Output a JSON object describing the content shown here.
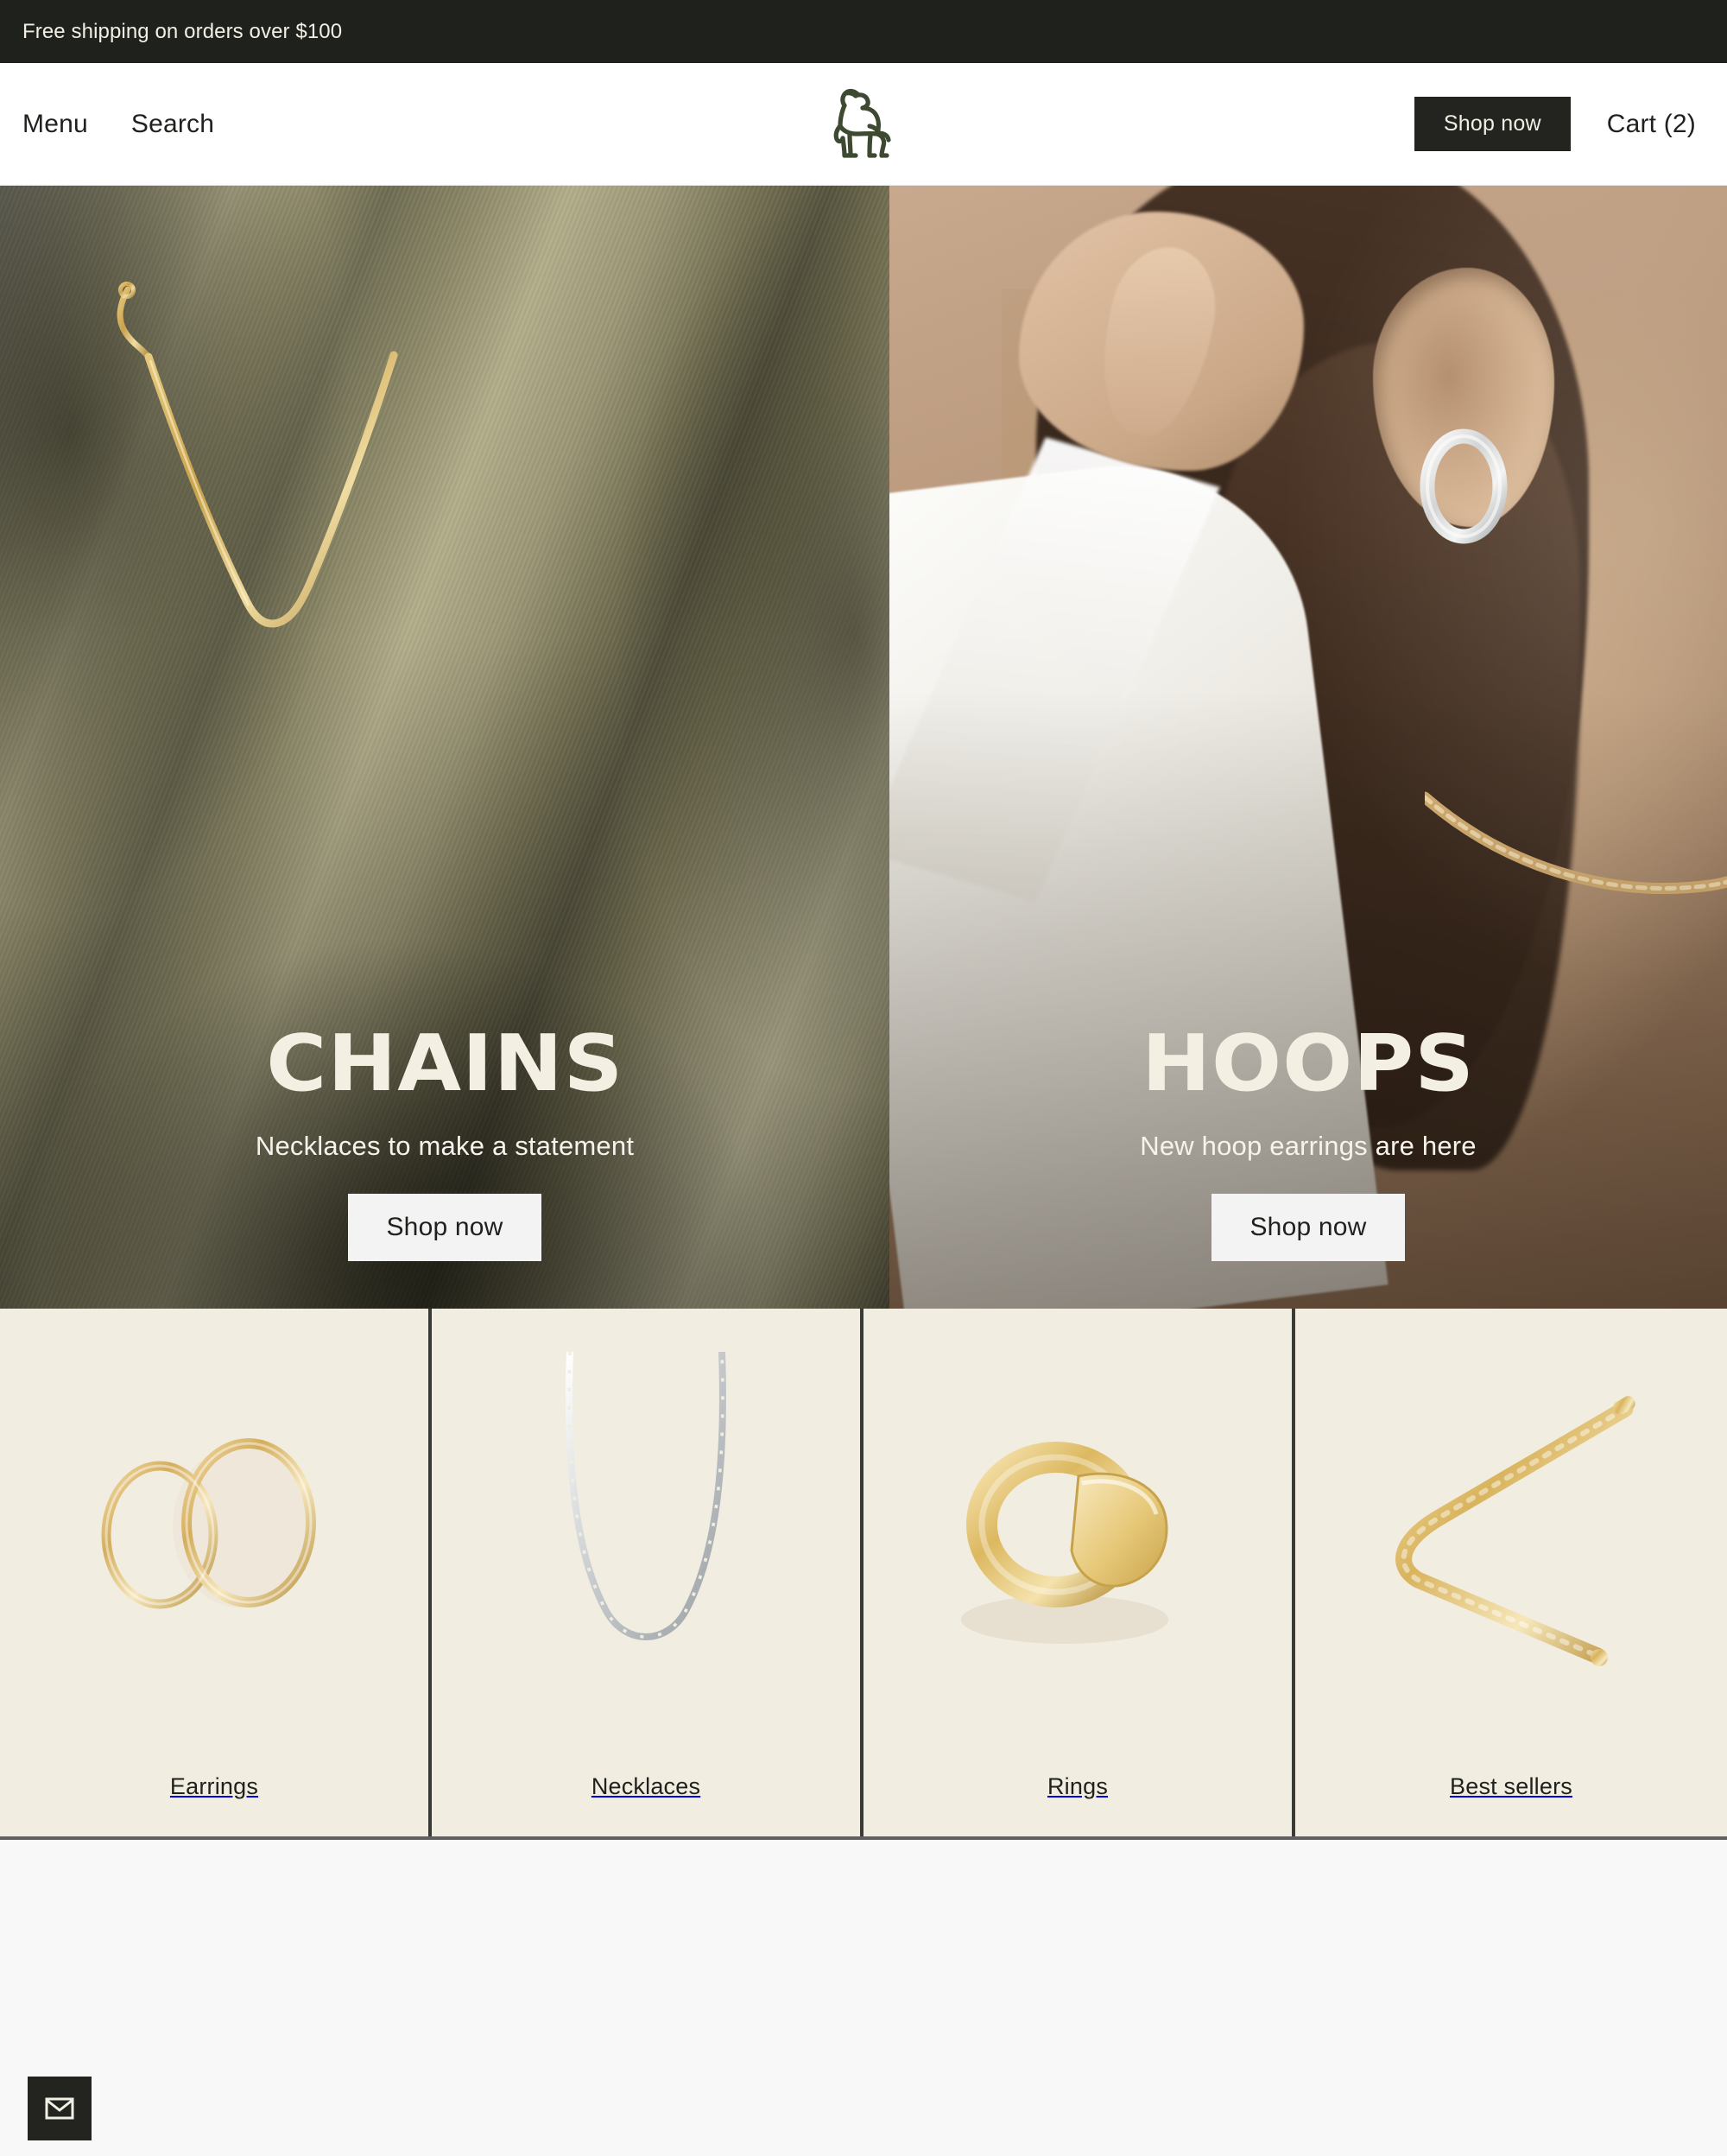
{
  "announcement": {
    "text": "Free shipping on orders over $100"
  },
  "header": {
    "menu_label": "Menu",
    "search_label": "Search",
    "logo_name": "greyhound-logo",
    "shop_now_label": "Shop now",
    "cart_label": "Cart (2)"
  },
  "hero": {
    "panels": [
      {
        "title": "CHAINS",
        "subtitle": "Necklaces to make a statement",
        "cta": "Shop now"
      },
      {
        "title": "HOOPS",
        "subtitle": "New hoop earrings are here",
        "cta": "Shop now"
      }
    ]
  },
  "categories": [
    {
      "label": "Earrings"
    },
    {
      "label": "Necklaces"
    },
    {
      "label": "Rings"
    },
    {
      "label": "Best sellers"
    }
  ],
  "footer": {
    "email_icon": "envelope-icon"
  },
  "colors": {
    "announcement_bg": "#1f211d",
    "dark_button": "#232420",
    "cream_text": "#f2efe4",
    "card_bg": "#f2ede1",
    "logo_green": "#3d4a31",
    "page_bg": "#f8f8f8"
  }
}
